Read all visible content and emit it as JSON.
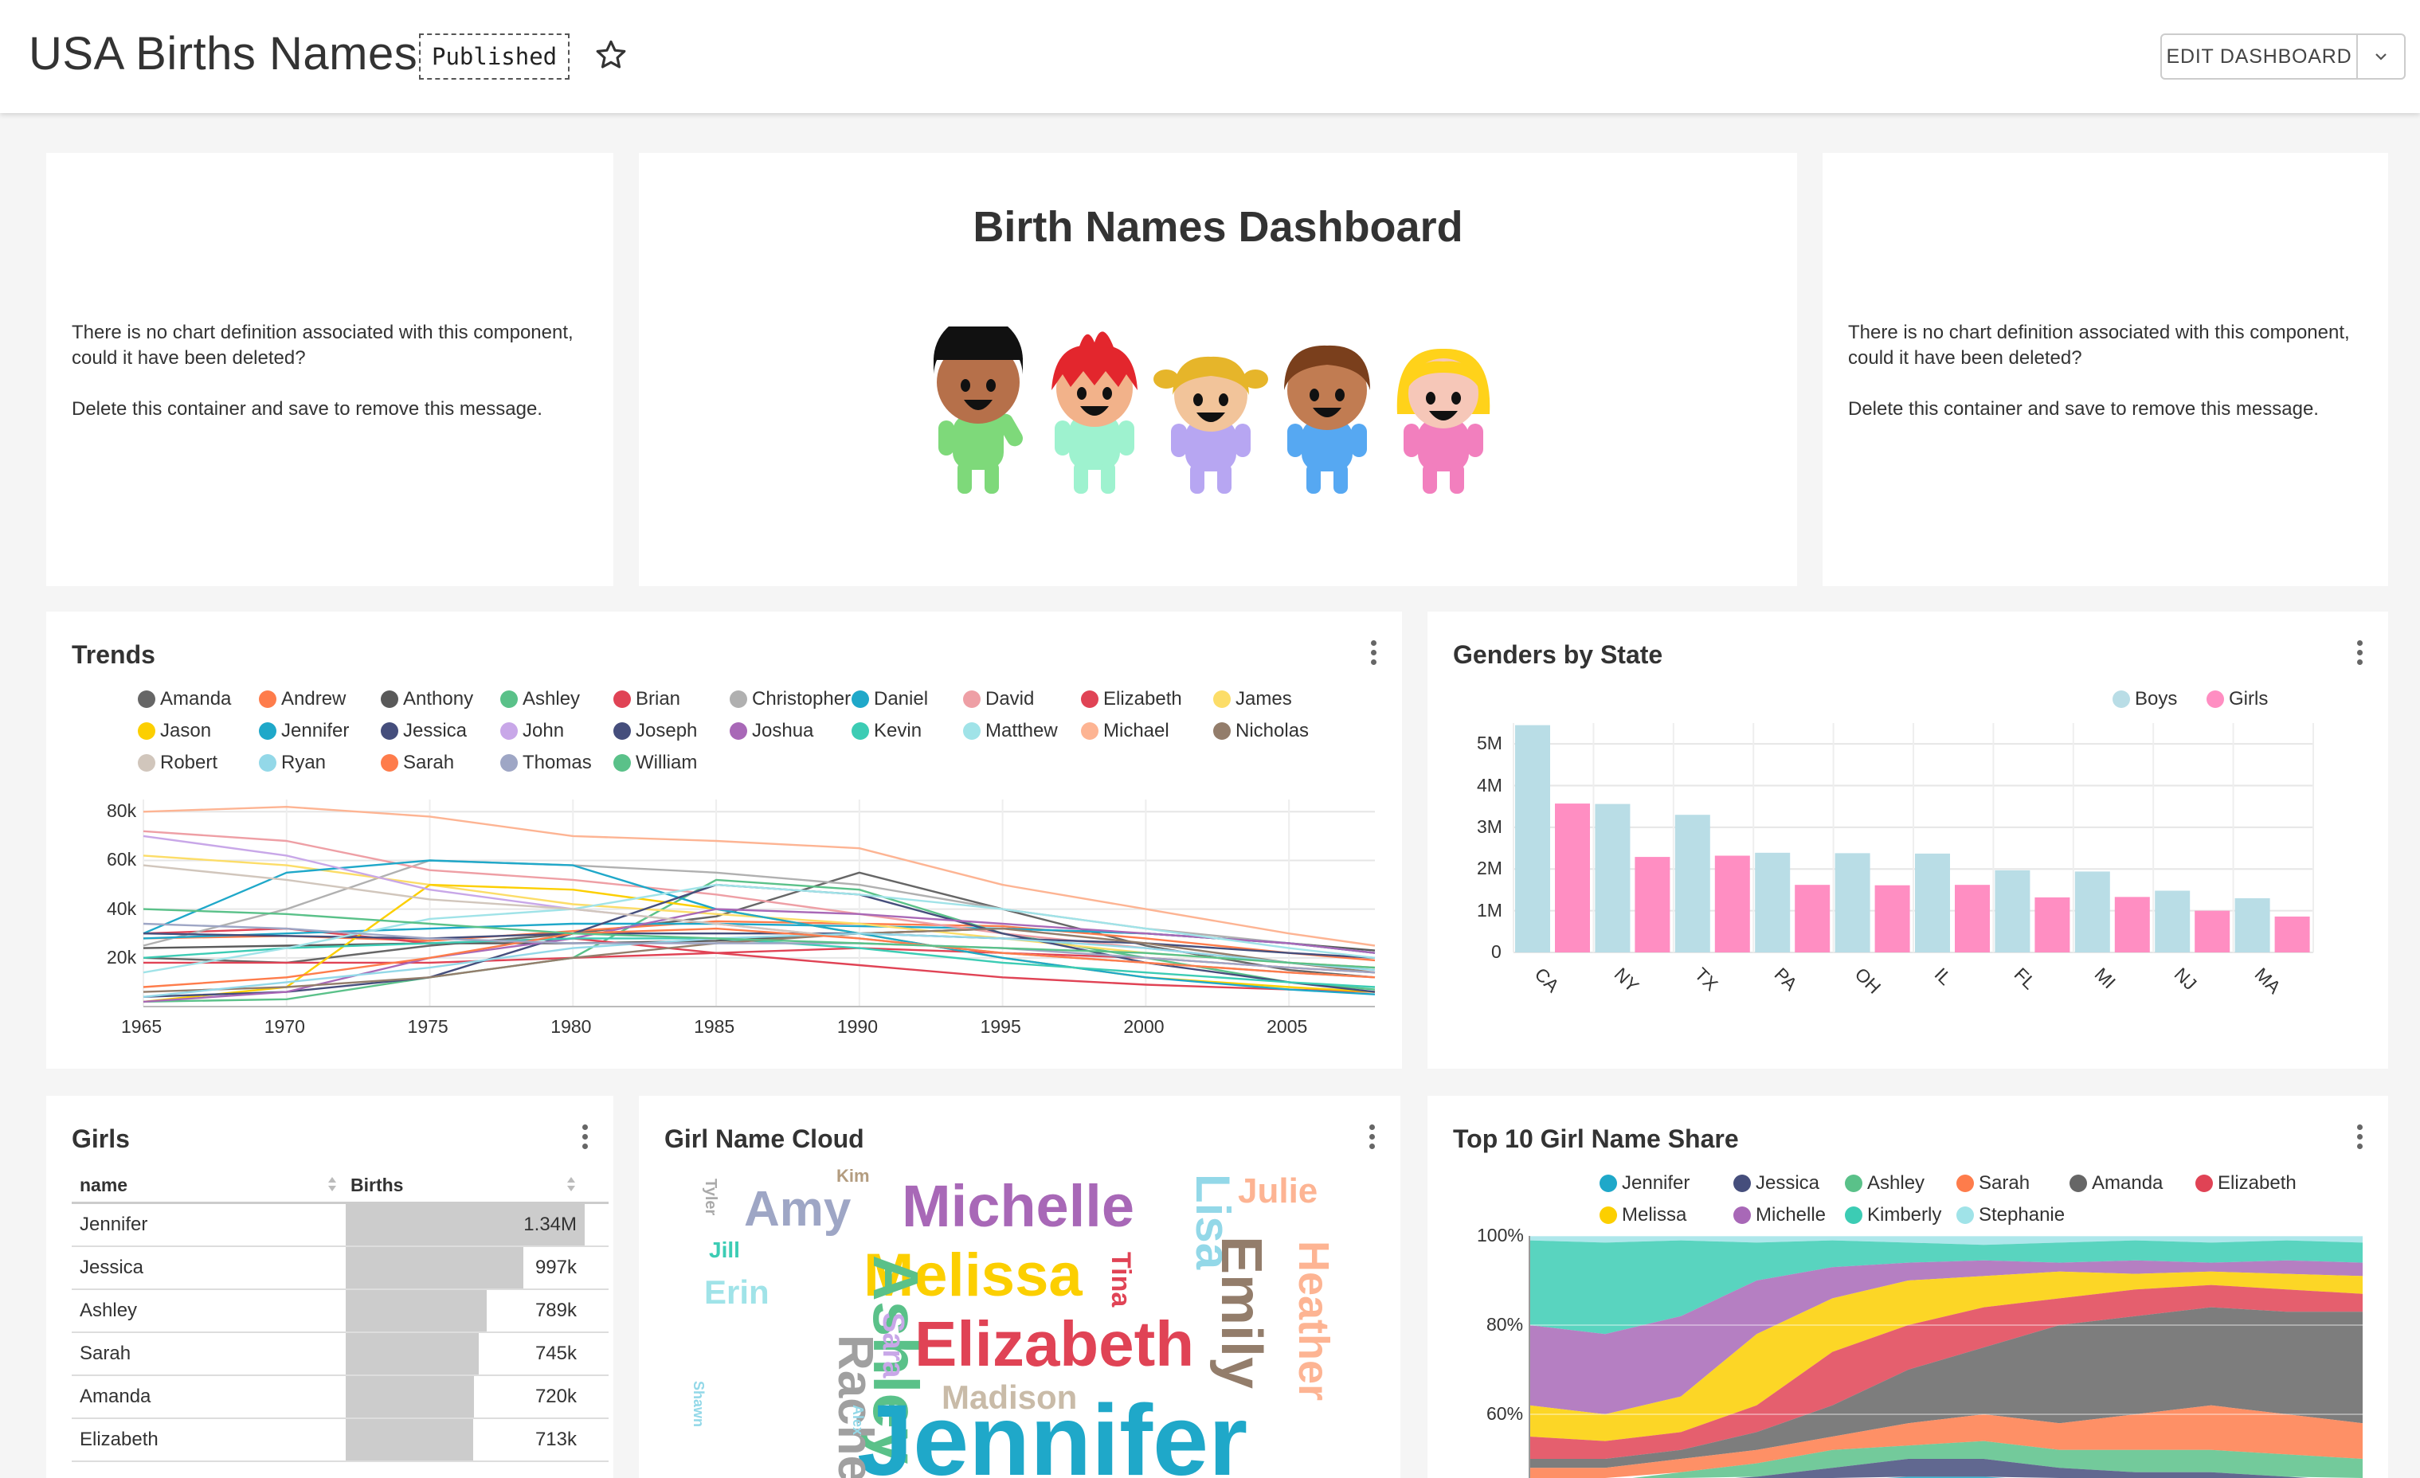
{
  "header": {
    "title": "USA Births Names",
    "status": "Published",
    "edit_label": "EDIT DASHBOARD"
  },
  "missing_chart": {
    "line1": "There is no chart definition associated with this component, could it have been deleted?",
    "line2": "Delete this container and save to remove this message."
  },
  "markdown": {
    "title": "Birth Names Dashboard",
    "image_alt": "five cartoon children"
  },
  "trends": {
    "title": "Trends",
    "chart_data": {
      "type": "line",
      "x": [
        1965,
        1970,
        1975,
        1980,
        1985,
        1990,
        1995,
        2000,
        2005,
        2008
      ],
      "ylim": [
        0,
        85000
      ],
      "yticks": [
        "80k",
        "60k",
        "40k",
        "20k"
      ],
      "xticks": [
        "1965",
        "1970",
        "1975",
        "1980",
        "1985",
        "1990",
        "1995",
        "2000",
        "2005"
      ],
      "series": [
        {
          "name": "Amanda",
          "color": "#666666",
          "values": [
            20000,
            18000,
            25000,
            30000,
            37000,
            55000,
            40000,
            25000,
            15000,
            12000
          ]
        },
        {
          "name": "Andrew",
          "color": "#fe7c4b",
          "values": [
            28000,
            29000,
            27000,
            31000,
            35000,
            34000,
            33000,
            28000,
            22000,
            19000
          ]
        },
        {
          "name": "Anthony",
          "color": "#595959",
          "values": [
            24000,
            25000,
            26000,
            26000,
            27000,
            30000,
            32000,
            30000,
            26000,
            23000
          ]
        },
        {
          "name": "Ashley",
          "color": "#5ac189",
          "values": [
            2000,
            3000,
            12000,
            20000,
            52000,
            48000,
            30000,
            20000,
            10000,
            7000
          ]
        },
        {
          "name": "Brian",
          "color": "#e04355",
          "values": [
            30000,
            32000,
            26000,
            28000,
            22000,
            17000,
            12000,
            9000,
            7000,
            6000
          ]
        },
        {
          "name": "Christopher",
          "color": "#b0b0b0",
          "values": [
            25000,
            40000,
            60000,
            58000,
            55000,
            50000,
            40000,
            32000,
            26000,
            22000
          ]
        },
        {
          "name": "Daniel",
          "color": "#1fa8c9",
          "values": [
            28000,
            30000,
            32000,
            34000,
            34000,
            33000,
            32000,
            30000,
            26000,
            22000
          ]
        },
        {
          "name": "David",
          "color": "#ee9fa5",
          "values": [
            72000,
            68000,
            56000,
            52000,
            46000,
            38000,
            30000,
            24000,
            18000,
            16000
          ]
        },
        {
          "name": "Elizabeth",
          "color": "#e04355",
          "values": [
            18000,
            18000,
            18000,
            20000,
            22000,
            24000,
            22000,
            20000,
            16000,
            14000
          ]
        },
        {
          "name": "James",
          "color": "#fcdd68",
          "values": [
            62000,
            58000,
            50000,
            42000,
            38000,
            34000,
            28000,
            22000,
            18000,
            16000
          ]
        },
        {
          "name": "Jason",
          "color": "#fccf00",
          "values": [
            2000,
            8000,
            50000,
            48000,
            40000,
            30000,
            20000,
            12000,
            8000,
            6000
          ]
        },
        {
          "name": "Jennifer",
          "color": "#1fa8c9",
          "values": [
            30000,
            55000,
            60000,
            58000,
            40000,
            30000,
            20000,
            12000,
            7000,
            5000
          ]
        },
        {
          "name": "Jessica",
          "color": "#454e7c",
          "values": [
            4000,
            6000,
            12000,
            30000,
            50000,
            46000,
            30000,
            18000,
            10000,
            6000
          ]
        },
        {
          "name": "John",
          "color": "#c8a7e8",
          "values": [
            70000,
            62000,
            48000,
            40000,
            34000,
            28000,
            22000,
            18000,
            14000,
            12000
          ]
        },
        {
          "name": "Joseph",
          "color": "#454e7c",
          "values": [
            30000,
            29000,
            28000,
            30000,
            30000,
            30000,
            28000,
            26000,
            22000,
            20000
          ]
        },
        {
          "name": "Joshua",
          "color": "#a868b7",
          "values": [
            2000,
            6000,
            20000,
            28000,
            40000,
            38000,
            34000,
            30000,
            26000,
            22000
          ]
        },
        {
          "name": "Kevin",
          "color": "#3cccb4",
          "values": [
            20000,
            24000,
            26000,
            28000,
            28000,
            24000,
            18000,
            14000,
            10000,
            8000
          ]
        },
        {
          "name": "Matthew",
          "color": "#a0e3e8",
          "values": [
            14000,
            24000,
            36000,
            40000,
            50000,
            46000,
            40000,
            32000,
            24000,
            20000
          ]
        },
        {
          "name": "Michael",
          "color": "#fdb493",
          "values": [
            80000,
            82000,
            78000,
            70000,
            68000,
            65000,
            50000,
            40000,
            30000,
            25000
          ]
        },
        {
          "name": "Nicholas",
          "color": "#937d6b",
          "values": [
            6000,
            8000,
            12000,
            20000,
            26000,
            30000,
            32000,
            26000,
            18000,
            14000
          ]
        },
        {
          "name": "Robert",
          "color": "#d1c6bc",
          "values": [
            58000,
            52000,
            44000,
            40000,
            34000,
            28000,
            22000,
            18000,
            14000,
            12000
          ]
        },
        {
          "name": "Ryan",
          "color": "#93d8e8",
          "values": [
            4000,
            10000,
            16000,
            24000,
            28000,
            30000,
            28000,
            24000,
            18000,
            15000
          ]
        },
        {
          "name": "Sarah",
          "color": "#fe7c4b",
          "values": [
            8000,
            12000,
            20000,
            30000,
            32000,
            28000,
            22000,
            18000,
            14000,
            12000
          ]
        },
        {
          "name": "Thomas",
          "color": "#9ea6c5",
          "values": [
            34000,
            32000,
            28000,
            26000,
            26000,
            26000,
            24000,
            20000,
            16000,
            14000
          ]
        },
        {
          "name": "William",
          "color": "#5ac189",
          "values": [
            40000,
            38000,
            34000,
            30000,
            28000,
            26000,
            24000,
            22000,
            18000,
            16000
          ]
        }
      ]
    }
  },
  "genders": {
    "title": "Genders by State",
    "chart_data": {
      "type": "bar",
      "categories": [
        "CA",
        "NY",
        "TX",
        "PA",
        "OH",
        "IL",
        "FL",
        "MI",
        "NJ",
        "MA"
      ],
      "series": [
        {
          "name": "Boys",
          "color": "#b9dde6",
          "values": [
            5450000,
            3560000,
            3300000,
            2390000,
            2380000,
            2370000,
            1970000,
            1940000,
            1480000,
            1300000
          ]
        },
        {
          "name": "Girls",
          "color": "#ff8ec2",
          "values": [
            3570000,
            2290000,
            2320000,
            1620000,
            1610000,
            1620000,
            1320000,
            1330000,
            1000000,
            860000
          ]
        }
      ],
      "yticks": [
        "5M",
        "4M",
        "3M",
        "2M",
        "1M",
        "0"
      ],
      "ylim": [
        0,
        5500000
      ]
    }
  },
  "girls": {
    "title": "Girls",
    "col_name": "name",
    "col_births": "Births",
    "rows": [
      {
        "name": "Jennifer",
        "births": "1.34M",
        "frac": 1.0
      },
      {
        "name": "Jessica",
        "births": "997k",
        "frac": 0.744
      },
      {
        "name": "Ashley",
        "births": "789k",
        "frac": 0.589
      },
      {
        "name": "Sarah",
        "births": "745k",
        "frac": 0.556
      },
      {
        "name": "Amanda",
        "births": "720k",
        "frac": 0.537
      },
      {
        "name": "Elizabeth",
        "births": "713k",
        "frac": 0.532
      }
    ]
  },
  "cloud": {
    "title": "Girl Name Cloud",
    "words": [
      "Amy",
      "Kim",
      "Michelle",
      "Julie",
      "Tyler",
      "Jill",
      "Erin",
      "Melissa",
      "Lisa",
      "Tina",
      "Emily",
      "Heather",
      "Ashley",
      "Sara",
      "Elizabeth",
      "Madison",
      "Jennifer",
      "Shawn",
      "Rachel",
      "Alex"
    ]
  },
  "share": {
    "title": "Top 10 Girl Name Share",
    "chart_data": {
      "type": "area",
      "yticks": [
        "100%",
        "80%",
        "60%"
      ],
      "legend": [
        "Jennifer",
        "Jessica",
        "Ashley",
        "Sarah",
        "Amanda",
        "Elizabeth",
        "Melissa",
        "Michelle",
        "Kimberly",
        "Stephanie"
      ],
      "colors": [
        "#1fa8c9",
        "#454e7c",
        "#5ac189",
        "#fe7c4b",
        "#666666",
        "#e04355",
        "#fccf00",
        "#a868b7",
        "#3cccb4",
        "#a0e3e8"
      ]
    }
  }
}
